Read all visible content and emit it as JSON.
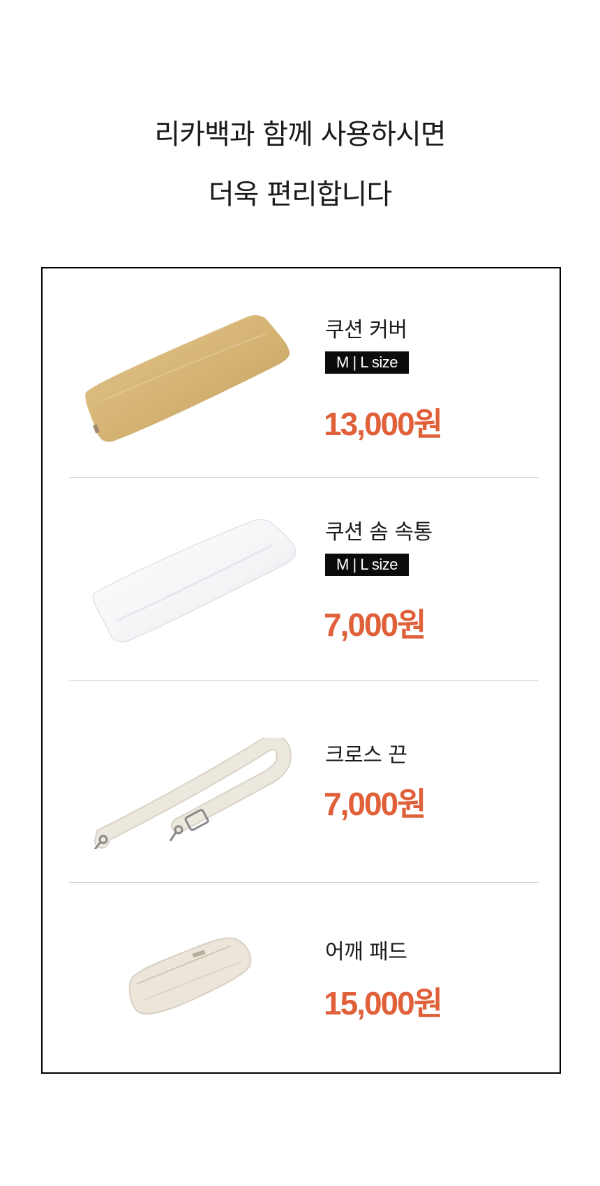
{
  "headline": {
    "line1": "리카백과 함께 사용하시면",
    "line2": "더욱 편리합니다"
  },
  "colors": {
    "price": "#e0603a",
    "badge_bg": "#0b0b0b",
    "border": "#000000",
    "divider": "#c9c9c9"
  },
  "products": [
    {
      "name": "쿠션 커버",
      "badge": "M | L size",
      "price": "13,000원",
      "image": "beige-cushion-cover"
    },
    {
      "name": "쿠션 솜 속통",
      "badge": "M | L size",
      "price": "7,000원",
      "image": "white-cushion-insert"
    },
    {
      "name": "크로스 끈",
      "price": "7,000원",
      "image": "cross-strap"
    },
    {
      "name": "어깨 패드",
      "price": "15,000원",
      "image": "shoulder-pad"
    }
  ]
}
